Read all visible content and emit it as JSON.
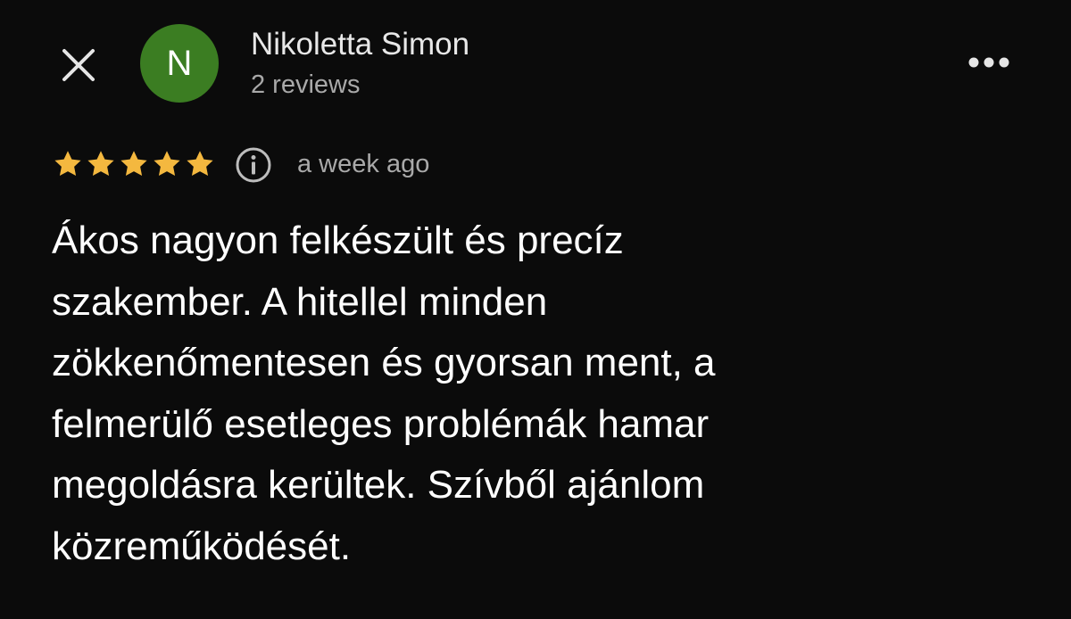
{
  "header": {
    "close_icon": "close-icon",
    "more_icon": "more-horizontal-icon",
    "avatar": {
      "initial": "N",
      "color": "#3b7d22"
    },
    "user_name": "Nikoletta Simon",
    "review_count": "2 reviews"
  },
  "review": {
    "rating": 5,
    "rating_max": 5,
    "star_color": "#f4b83f",
    "info_icon": "info-icon",
    "date": "a week ago",
    "text_lines": [
      "Ákos nagyon felkészült és precíz",
      "szakember. A hitellel minden",
      "zökkenőmentesen és gyorsan ment, a",
      "felmerülő esetleges problémák hamar",
      "megoldásra kerültek. Szívből ajánlom",
      "közreműködését."
    ]
  }
}
